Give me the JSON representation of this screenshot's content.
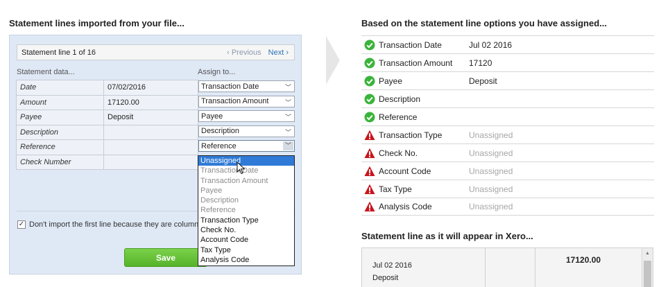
{
  "left": {
    "heading": "Statement lines imported from your file...",
    "line_title": "Statement line 1 of 16",
    "prev_label": "‹ Previous",
    "next_label": "Next ›",
    "statement_data_label": "Statement data...",
    "assign_to_label": "Assign to...",
    "rows": [
      {
        "field": "Date",
        "value": "07/02/2016",
        "assigned": "Transaction Date"
      },
      {
        "field": "Amount",
        "value": "17120.00",
        "assigned": "Transaction Amount"
      },
      {
        "field": "Payee",
        "value": "Deposit",
        "assigned": "Payee"
      },
      {
        "field": "Description",
        "value": "",
        "assigned": "Description"
      },
      {
        "field": "Reference",
        "value": "",
        "assigned": "Reference"
      },
      {
        "field": "Check Number",
        "value": "",
        "assigned": ""
      }
    ],
    "dropdown_options": [
      "Unassigned",
      "Transaction Date",
      "Transaction Amount",
      "Payee",
      "Description",
      "Reference",
      "Transaction Type",
      "Check No.",
      "Account Code",
      "Tax Type",
      "Analysis Code"
    ],
    "checkbox_label": "Don't import the first line because they are column headings",
    "save_label": "Save"
  },
  "right": {
    "heading": "Based on the statement line options you have assigned...",
    "rows": [
      {
        "status": "ok",
        "label": "Transaction Date",
        "value": "Jul 02 2016"
      },
      {
        "status": "ok",
        "label": "Transaction Amount",
        "value": "17120"
      },
      {
        "status": "ok",
        "label": "Payee",
        "value": "Deposit"
      },
      {
        "status": "ok",
        "label": "Description",
        "value": ""
      },
      {
        "status": "ok",
        "label": "Reference",
        "value": ""
      },
      {
        "status": "warn",
        "label": "Transaction Type",
        "value": "Unassigned"
      },
      {
        "status": "warn",
        "label": "Check No.",
        "value": "Unassigned"
      },
      {
        "status": "warn",
        "label": "Account Code",
        "value": "Unassigned"
      },
      {
        "status": "warn",
        "label": "Tax Type",
        "value": "Unassigned"
      },
      {
        "status": "warn",
        "label": "Analysis Code",
        "value": "Unassigned"
      }
    ],
    "preview_heading": "Statement line as it will appear in Xero...",
    "preview_date": "Jul 02 2016",
    "preview_payee": "Deposit",
    "preview_amount": "17120.00"
  },
  "colors": {
    "ok": "#3bb43b",
    "warn": "#c9141c",
    "accent": "#2a72b5",
    "selected": "#2f7ad6"
  }
}
